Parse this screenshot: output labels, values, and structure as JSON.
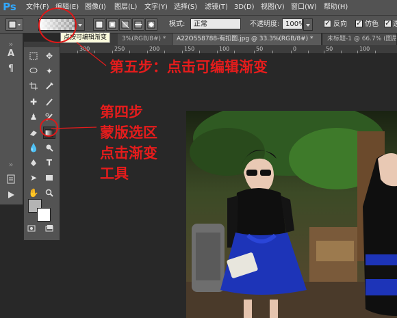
{
  "app": {
    "logo": "Ps"
  },
  "menu": [
    "文件(F)",
    "编辑(E)",
    "图像(I)",
    "图层(L)",
    "文字(Y)",
    "选择(S)",
    "滤镜(T)",
    "3D(D)",
    "视图(V)",
    "窗口(W)",
    "帮助(H)"
  ],
  "options_bar": {
    "mode_label": "模式:",
    "mode_value": "正常",
    "opacity_label": "不透明度:",
    "opacity_value": "100%",
    "reverse_label": "反向",
    "dither_label": "仿色",
    "transparency_label": "透"
  },
  "tooltip": "点按可编辑渐变",
  "tabs": [
    "3%(RGB/8#) *",
    "A22O558788-有扣图.jpg @ 33.3%(RGB/8#) *",
    "未标题-1 @ 66.7% (图层"
  ],
  "ruler_marks": [
    "300",
    "250",
    "200",
    "150",
    "100",
    "50",
    "0",
    "50",
    "100"
  ],
  "annotations": {
    "step5": "第五步：点击可编辑渐变",
    "step4_lines": [
      "第四步",
      "蒙版选区",
      "点击渐变",
      "工具"
    ]
  },
  "colors": {
    "annotation": "#e51c1c",
    "ui_panel": "#535353",
    "canvas_bg": "#282828",
    "foreground": "#b4b4b4",
    "background": "#ffffff"
  }
}
